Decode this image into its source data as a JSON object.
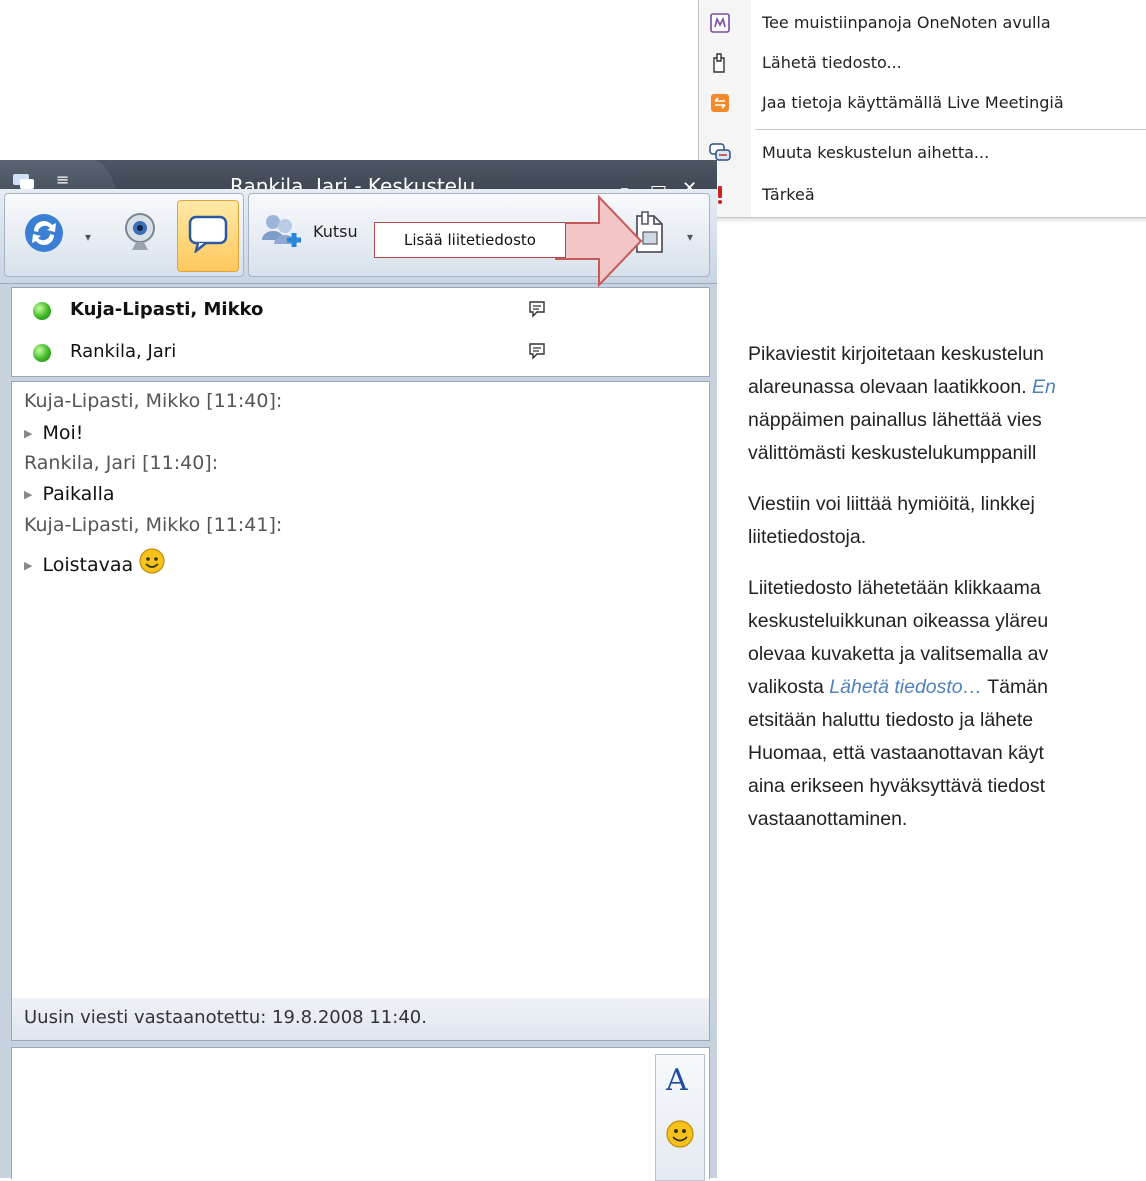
{
  "context_menu": {
    "items": [
      {
        "icon": "onenote-icon",
        "label": "Tee muistiinpanoja OneNoten avulla"
      },
      {
        "icon": "send-file-icon",
        "label": "Lähetä tiedosto..."
      },
      {
        "icon": "live-meeting-icon",
        "label": "Jaa tietoja käyttämällä Live Meetingiä"
      },
      {
        "icon": "change-topic-icon",
        "label": "Muuta keskustelun aihetta..."
      },
      {
        "icon": "important-icon",
        "label": "Tärkeä"
      }
    ]
  },
  "window": {
    "title": "Rankila, Jari - Keskustelu",
    "min_glyph": "–",
    "max_glyph": "▭",
    "close_glyph": "✕"
  },
  "toolbar": {
    "invite_label": "Kutsu",
    "tooltip": "Lisää liitetiedosto"
  },
  "participants": [
    {
      "name": "Kuja-Lipasti, Mikko",
      "bold": true
    },
    {
      "name": "Rankila, Jari",
      "bold": false
    }
  ],
  "conversation": {
    "messages": [
      {
        "header": "Kuja-Lipasti, Mikko [11:40]:",
        "text": "Moi!"
      },
      {
        "header": "Rankila, Jari [11:40]:",
        "text": "Paikalla"
      },
      {
        "header": "Kuja-Lipasti, Mikko [11:41]:",
        "text": "Loistavaa"
      }
    ],
    "status": "Uusin viesti vastaanotettu: 19.8.2008 11:40."
  },
  "format_panel": {
    "font_glyph": "A"
  },
  "document": {
    "p1": {
      "l1": "Pikaviestit kirjoitetaan keskustelun",
      "l2a": "alareunassa olevaan laatikkoon. ",
      "l2b": "En",
      "l3": "näppäimen painallus lähettää vies",
      "l4": "välittömästi keskustelukumppanill"
    },
    "p2": {
      "l1": "Viestiin voi liittää hymiöitä, linkkej",
      "l2": "liitetiedostoja."
    },
    "p3": {
      "l1": "Liitetiedosto lähetetään klikkaama",
      "l2": "keskusteluikkunan oikeassa yläreu",
      "l3": "olevaa kuvaketta ja valitsemalla av",
      "l4a": "valikosta ",
      "l4b": "Lähetä tiedosto…",
      "l4c": " Tämän",
      "l5": "etsitään haluttu tiedosto ja lähete",
      "l6": "Huomaa, että vastaanottavan käyt",
      "l7": "aina erikseen hyväksyttävä tiedost",
      "l8": "vastaanottaminen."
    }
  },
  "colors": {
    "title_bar": "#3a434f",
    "active_button": "#ffc85c",
    "presence_online": "#3cb626",
    "link_text": "#4f81bd",
    "tooltip_border": "#b04a4a",
    "arrow_fill": "#f2c6c6"
  }
}
